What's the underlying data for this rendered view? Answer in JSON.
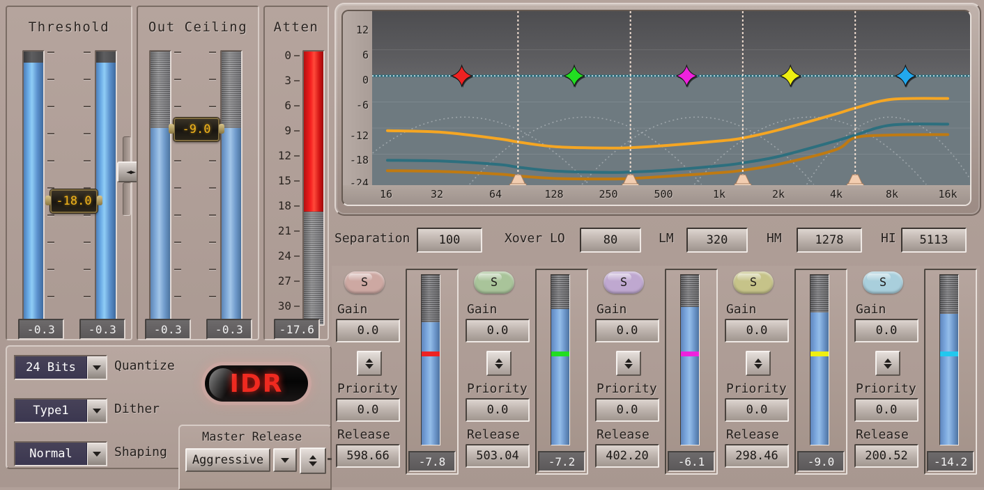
{
  "left": {
    "threshold": {
      "title": "Threshold",
      "handle_value": "-18.0",
      "readout_left": "-0.3",
      "readout_right": "-0.3"
    },
    "out_ceiling": {
      "title": "Out Ceiling",
      "handle_value": "-9.0",
      "readout_left": "-0.3",
      "readout_right": "-0.3"
    },
    "atten": {
      "title": "Atten",
      "scale": [
        "0",
        "3",
        "6",
        "9",
        "12",
        "15",
        "18",
        "21",
        "24",
        "27",
        "30"
      ],
      "readout": "-17.6",
      "fill_db": 17.6,
      "fill_color": "#ee1111"
    },
    "link_button_glyph": "◄►"
  },
  "idr": {
    "quantize": {
      "value": "24 Bits",
      "label": "Quantize"
    },
    "dither": {
      "value": "Type1",
      "label": "Dither"
    },
    "shaping": {
      "value": "Normal",
      "label": "Shaping"
    },
    "led_label": "IDR",
    "led_color": "#ef2a20"
  },
  "master_release": {
    "title": "Master Release",
    "value": "Aggressive"
  },
  "xover_row": {
    "separation_label": "Separation",
    "separation_value": "100",
    "fields": [
      {
        "label": "Xover LO",
        "value": "80"
      },
      {
        "label": "LM",
        "value": "320"
      },
      {
        "label": "HM",
        "value": "1278"
      },
      {
        "label": "HI",
        "value": "5113"
      }
    ]
  },
  "chart_data": {
    "type": "line",
    "title": "",
    "xlabel": "",
    "ylabel": "",
    "x_ticks": [
      "16",
      "32",
      "64",
      "128",
      "250",
      "500",
      "1k",
      "2k",
      "4k",
      "8k",
      "16k"
    ],
    "y_ticks": [
      "12",
      "6",
      "0",
      "-6",
      "-12",
      "-18",
      "-24"
    ],
    "ylim": [
      -24,
      12
    ],
    "xlim_hz": [
      16,
      16000
    ],
    "grid": true,
    "legend": "none",
    "threshold_line_db": 0,
    "band_markers": [
      {
        "name": "band-1-marker",
        "color": "#ee2222",
        "hz": 40,
        "db": 0
      },
      {
        "name": "band-2-marker",
        "color": "#22dd22",
        "hz": 160,
        "db": 0
      },
      {
        "name": "band-3-marker",
        "color": "#ee22dd",
        "hz": 640,
        "db": 0
      },
      {
        "name": "band-4-marker",
        "color": "#eeee11",
        "hz": 2300,
        "db": 0
      },
      {
        "name": "band-5-marker",
        "color": "#22a8ee",
        "hz": 9500,
        "db": 0
      }
    ],
    "crossover_handles_hz": [
      80,
      320,
      1278,
      5113
    ],
    "series": [
      {
        "name": "output-orange",
        "color": "#f5a623",
        "x_hz": [
          16,
          32,
          64,
          80,
          128,
          250,
          320,
          500,
          1000,
          1278,
          2000,
          4000,
          5113,
          8000,
          16000
        ],
        "y_db": [
          -12.6,
          -13.0,
          -14.5,
          -15.2,
          -16.3,
          -16.6,
          -16.5,
          -16.0,
          -14.9,
          -14.3,
          -12.4,
          -8.8,
          -7.4,
          -5.4,
          -5.2
        ]
      },
      {
        "name": "input-teal",
        "color": "#2d6f7e",
        "x_hz": [
          16,
          32,
          64,
          80,
          128,
          250,
          320,
          500,
          1000,
          1278,
          2000,
          4000,
          5113,
          8000,
          16000
        ],
        "y_db": [
          -19.4,
          -19.6,
          -20.4,
          -21.0,
          -21.9,
          -22.2,
          -22.1,
          -21.7,
          -20.6,
          -20.0,
          -18.5,
          -15.0,
          -13.6,
          -11.3,
          -11.1
        ]
      },
      {
        "name": "reduction-brown",
        "color": "#bf7a12",
        "x_hz": [
          16,
          32,
          64,
          80,
          128,
          250,
          320,
          500,
          1000,
          1278,
          2000,
          4000,
          5113,
          8000,
          16000
        ],
        "y_db": [
          -21.8,
          -22.0,
          -22.6,
          -23.0,
          -23.6,
          -23.7,
          -23.6,
          -23.1,
          -22.2,
          -21.7,
          -20.3,
          -17.0,
          -14.2,
          -13.6,
          -13.5
        ]
      }
    ]
  },
  "bands": [
    {
      "id": "band-1",
      "solo_label": "S",
      "solo_color": "#cda8a2",
      "gain_label": "Gain",
      "gain_value": "0.0",
      "priority_label": "Priority",
      "priority_value": "0.0",
      "release_label": "Release",
      "release_value": "598.66",
      "meter_value": "-7.8",
      "meter_fill_pct": 72,
      "mark_color": "#ee2222",
      "mark_pct": 45
    },
    {
      "id": "band-2",
      "solo_label": "S",
      "solo_color": "#a9c49a",
      "gain_label": "Gain",
      "gain_value": "0.0",
      "priority_label": "Priority",
      "priority_value": "0.0",
      "release_label": "Release",
      "release_value": "503.04",
      "meter_value": "-7.2",
      "meter_fill_pct": 80,
      "mark_color": "#22dd22",
      "mark_pct": 45
    },
    {
      "id": "band-3",
      "solo_label": "S",
      "solo_color": "#bfa8d0",
      "gain_label": "Gain",
      "gain_value": "0.0",
      "priority_label": "Priority",
      "priority_value": "0.0",
      "release_label": "Release",
      "release_value": "402.20",
      "meter_value": "-6.1",
      "meter_fill_pct": 81,
      "mark_color": "#ee22dd",
      "mark_pct": 45
    },
    {
      "id": "band-4",
      "solo_label": "S",
      "solo_color": "#c6c389",
      "gain_label": "Gain",
      "gain_value": "0.0",
      "priority_label": "Priority",
      "priority_value": "0.0",
      "release_label": "Release",
      "release_value": "298.46",
      "meter_value": "-9.0",
      "meter_fill_pct": 78,
      "mark_color": "#eeee11",
      "mark_pct": 45
    },
    {
      "id": "band-5",
      "solo_label": "S",
      "solo_color": "#a9cfdc",
      "gain_label": "Gain",
      "gain_value": "0.0",
      "priority_label": "Priority",
      "priority_value": "0.0",
      "release_label": "Release",
      "release_value": "200.52",
      "meter_value": "-14.2",
      "meter_fill_pct": 77,
      "mark_color": "#22c8ee",
      "mark_pct": 45
    }
  ]
}
